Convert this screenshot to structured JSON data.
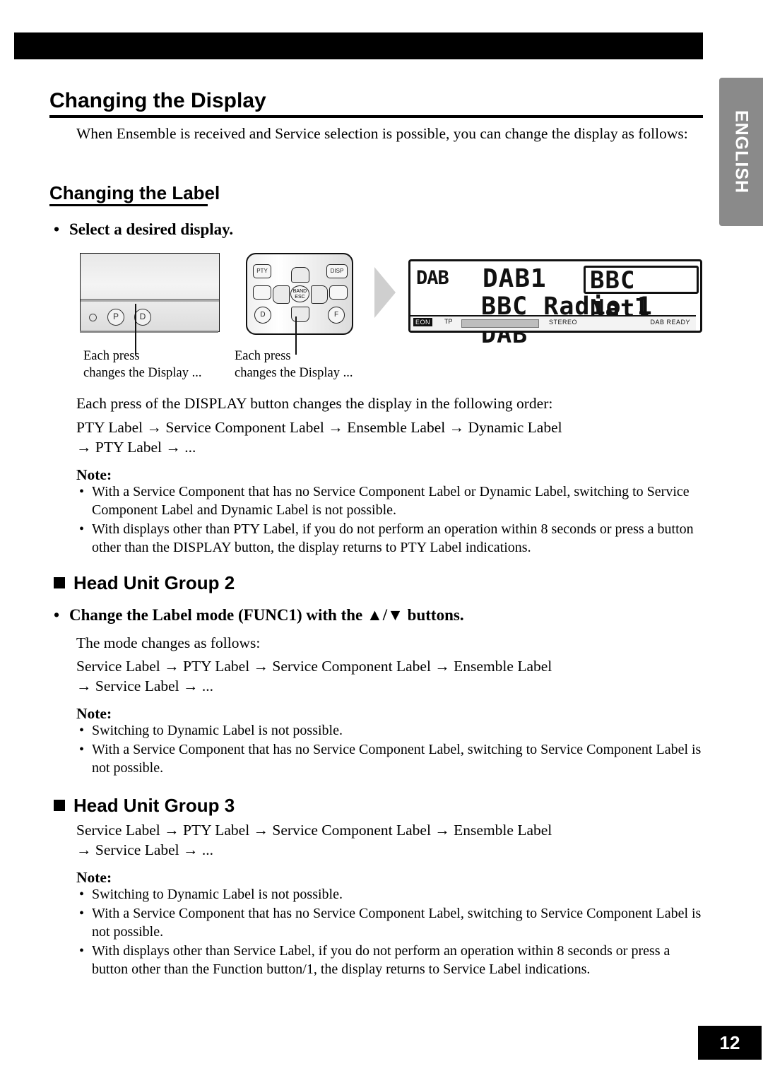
{
  "language_tab": "ENGLISH",
  "page_number": "12",
  "headings": {
    "h1": "Changing the Display",
    "h2": "Changing the Label"
  },
  "intro": "When Ensemble is received and Service selection is possible, you can change the display as follows:",
  "bullets": {
    "select_display": "Select a desired display.",
    "change_label_mode": "Change the Label mode (FUNC1) with the ▲/▼ buttons."
  },
  "figure": {
    "panel_button_1": "P",
    "panel_button_2": "D",
    "caption_left_line1": "Each press",
    "caption_left_line2": "changes the Display ...",
    "caption_right_line1": "Each press",
    "caption_right_line2": "changes the Display ...",
    "remote_buttons": {
      "pty": "PTY",
      "disp": "DISP",
      "band": "BAND",
      "esc": "ESC",
      "d": "D",
      "f": "F"
    }
  },
  "display": {
    "icon_text": "DAB",
    "main_text": "DAB1",
    "boxed_text": "BBC Natl",
    "second_line": "BBC Radio 1 DAB",
    "indicator_eon": "EON",
    "indicator_tp": "TP",
    "indicator_stereo": "STEREO",
    "indicator_dab_ready": "DAB READY"
  },
  "display_order": {
    "lead_in": "Each press of the DISPLAY button changes the display in the following order:",
    "sequence_line1": "PTY Label → Service Component Label → Ensemble Label → Dynamic Label",
    "sequence_line2": "→ PTY Label → ..."
  },
  "note_label": "Note:",
  "notes_display": [
    "With a Service Component that has no Service Component Label or Dynamic Label, switching to Service Component Label and Dynamic Label is not possible.",
    "With displays other than PTY Label, if you do not perform an operation within 8 seconds or press a button other than the DISPLAY button, the display returns to PTY Label indications."
  ],
  "group2": {
    "title": "Head Unit Group 2",
    "mode_intro": "The mode changes as follows:",
    "sequence_line1": "Service Label → PTY Label → Service Component Label → Ensemble Label",
    "sequence_line2": "→ Service Label → ...",
    "notes": [
      "Switching to Dynamic Label is not possible.",
      "With a Service Component that has no Service Component Label, switching to Service Component Label is not possible."
    ]
  },
  "group3": {
    "title": "Head Unit Group 3",
    "sequence_line1": "Service Label → PTY Label → Service Component Label → Ensemble Label",
    "sequence_line2": "→ Service Label → ...",
    "notes": [
      "Switching to Dynamic Label is not possible.",
      "With a Service Component that has no Service Component Label, switching to Service Component Label is not possible.",
      "With displays other than Service Label, if you do not perform an operation within 8 seconds or press a button other than the Function button/1, the display returns to Service Label indications."
    ]
  }
}
